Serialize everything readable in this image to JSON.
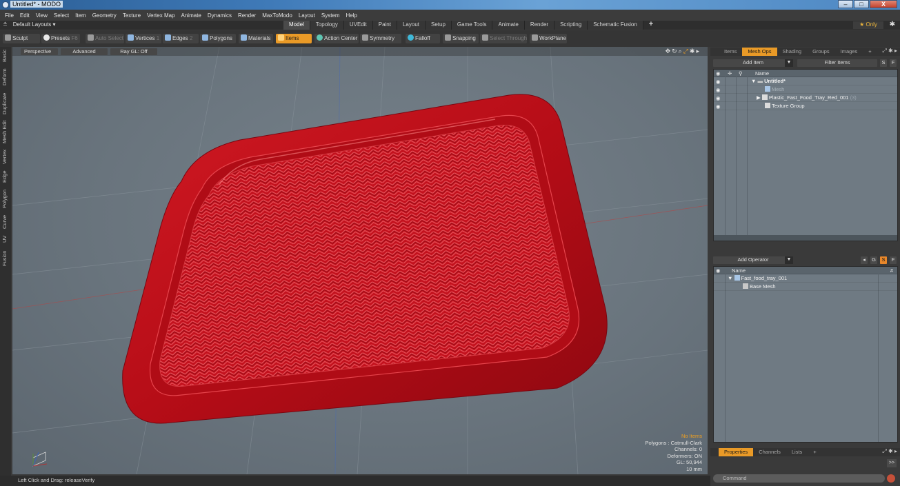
{
  "window": {
    "title": "Untitled* - MODO",
    "controls": [
      "–",
      "□",
      "X"
    ]
  },
  "menu": [
    "File",
    "Edit",
    "View",
    "Select",
    "Item",
    "Geometry",
    "Texture",
    "Vertex Map",
    "Animate",
    "Dynamics",
    "Render",
    "MaxToModo",
    "Layout",
    "System",
    "Help"
  ],
  "layout": {
    "label": "Default Layouts ▾",
    "tabs": [
      "Model",
      "Topology",
      "UVEdit",
      "Paint",
      "Layout",
      "Setup",
      "Game Tools",
      "Animate",
      "Render",
      "Scripting",
      "Schematic Fusion"
    ],
    "active_tab": "Model",
    "plus": "+",
    "only_label": "★  Only"
  },
  "toolbar": {
    "sculpt": "Sculpt",
    "presets": "Presets",
    "presets_key": "F6",
    "auto_select": "Auto Select",
    "vertices": "Vertices",
    "vertices_key": "1",
    "edges": "Edges",
    "edges_key": "2",
    "polygons": "Polygons",
    "materials": "Materials",
    "items": "Items",
    "action_center": "Action Center",
    "symmetry": "Symmetry",
    "falloff": "Falloff",
    "snapping": "Snapping",
    "select_through": "Select Through",
    "workplane": "WorkPlane"
  },
  "left_tabs": [
    "Basic",
    "Deform",
    "Duplicate",
    "Mesh Edit",
    "Vertex",
    "Edge",
    "Polygon",
    "Curve",
    "UV",
    "Fusion"
  ],
  "viewport": {
    "perspective": "Perspective",
    "advanced": "Advanced",
    "raygl": "Ray GL: Off",
    "stats": {
      "no_items": "No Items",
      "polygons": "Polygons : Catmull-Clark",
      "channels": "Channels: 0",
      "deformers": "Deformers: ON",
      "gl": "GL: 50,944",
      "scale": "10 mm"
    },
    "colors": {
      "tray": "#c8101c",
      "background": "#6b757e"
    }
  },
  "status": "Left Click and Drag:  releaseVerify",
  "items_panel": {
    "tabs": [
      "Items",
      "Mesh Ops",
      "Shading",
      "Groups",
      "Images",
      "+"
    ],
    "active": "Mesh Ops",
    "add_item": "Add Item",
    "filter": "Filter Items",
    "s_btn": "S",
    "f_btn": "F",
    "col_name": "Name",
    "rows": [
      {
        "label": "Untitled*",
        "indent": 0
      },
      {
        "label": "Mesh",
        "indent": 1
      },
      {
        "label": "Plastic_Fast_Food_Tray_Red_001",
        "suffix": "(3)",
        "indent": 1
      },
      {
        "label": "Texture Group",
        "indent": 1
      }
    ]
  },
  "operator_panel": {
    "add_operator": "Add Operator",
    "buttons": [
      "G",
      "S",
      "F"
    ],
    "col_name": "Name",
    "col_hash": "#",
    "rows": [
      {
        "label": "Fast_food_tray_001"
      },
      {
        "label": "Base Mesh"
      }
    ]
  },
  "properties_panel": {
    "tabs": [
      "Properties",
      "Channels",
      "Lists",
      "+"
    ],
    "active": "Properties",
    "expand": ">>"
  },
  "command": {
    "placeholder": "Command"
  }
}
